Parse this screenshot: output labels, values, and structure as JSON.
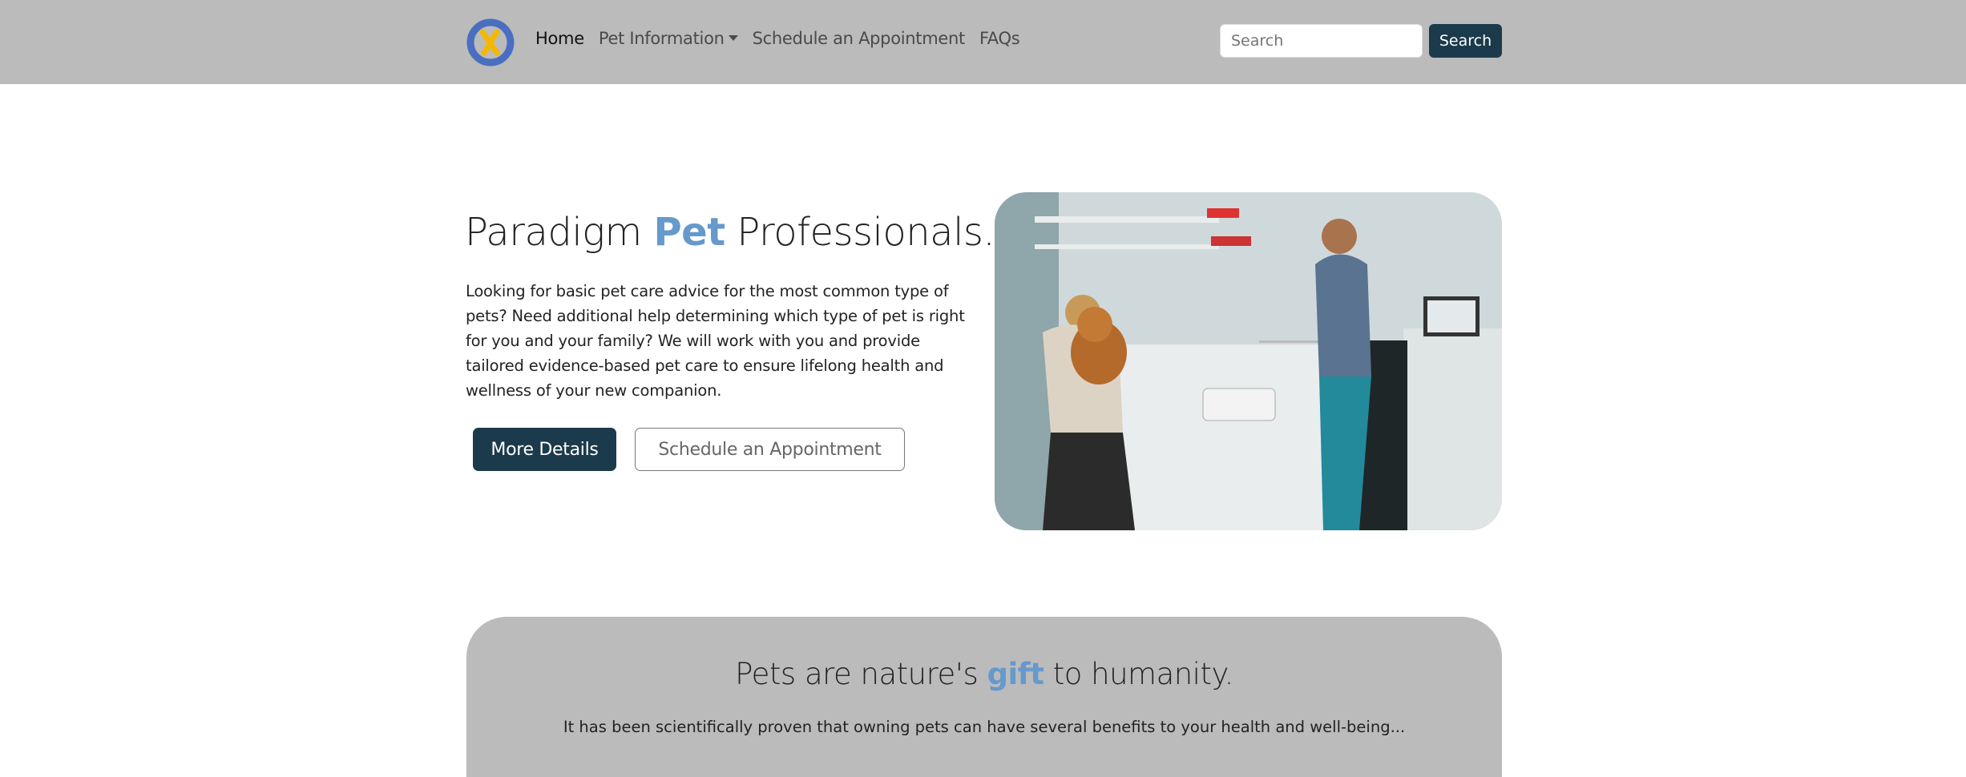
{
  "nav": {
    "links": [
      "Home",
      "Pet Information",
      "Schedule an Appointment",
      "FAQs"
    ],
    "search_placeholder": "Search",
    "search_button": "Search"
  },
  "hero": {
    "title_pre": "Paradigm ",
    "title_accent": "Pet",
    "title_post": " Professionals.",
    "paragraph": "Looking for basic pet care advice for the most common type of pets? Need additional help determining which type of pet is right for you and your family? We will work with you and provide tailored evidence-based pet care to ensure lifelong health and wellness of your new companion.",
    "primary_button": "More Details",
    "secondary_button": "Schedule an Appointment"
  },
  "section": {
    "title_pre": "Pets are nature's ",
    "title_accent": "gift",
    "title_post": " to humanity.",
    "paragraph": "It has been scientifically proven that owning pets can have several benefits to your health and well-being..."
  },
  "colors": {
    "navbar": "#bbbbbb",
    "primary": "#1b3a4b",
    "accent": "#6699cc"
  }
}
